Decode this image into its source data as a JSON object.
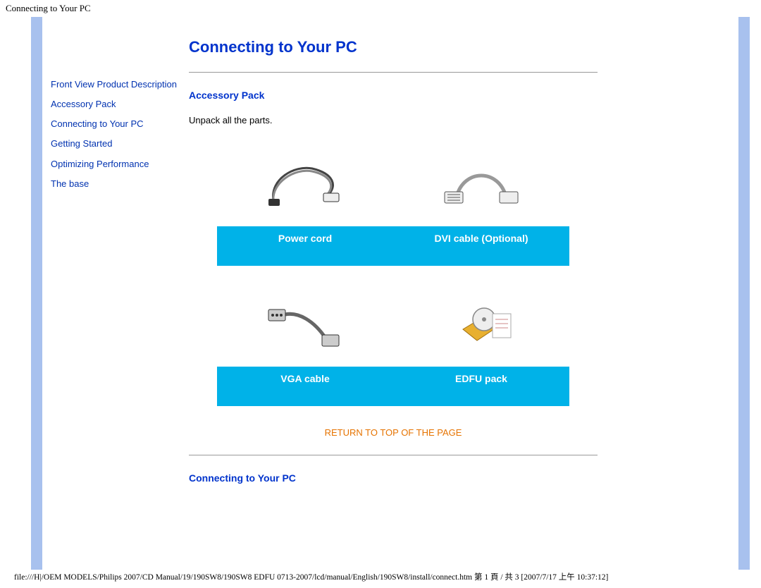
{
  "browser_title": "Connecting to Your PC",
  "sidebar": {
    "items": [
      "Front View Product Description",
      "Accessory Pack",
      "Connecting to Your PC",
      "Getting Started",
      "Optimizing Performance",
      "The base"
    ]
  },
  "main": {
    "title": "Connecting to Your PC",
    "accessory_heading": "Accessory Pack",
    "unpack_text": "Unpack all the parts.",
    "items": [
      {
        "label": "Power cord",
        "icon": "power-cord-icon"
      },
      {
        "label": "DVI cable (Optional)",
        "icon": "dvi-cable-icon"
      },
      {
        "label": "VGA cable",
        "icon": "vga-cable-icon"
      },
      {
        "label": "EDFU pack",
        "icon": "edfu-pack-icon"
      }
    ],
    "return_top": "RETURN TO TOP OF THE PAGE",
    "connecting_heading": "Connecting to Your PC"
  },
  "footer": "file:///H|/OEM MODELS/Philips 2007/CD Manual/19/190SW8/190SW8 EDFU 0713-2007/lcd/manual/English/190SW8/install/connect.htm 第 1 頁 / 共 3  [2007/7/17 上午 10:37:12]"
}
